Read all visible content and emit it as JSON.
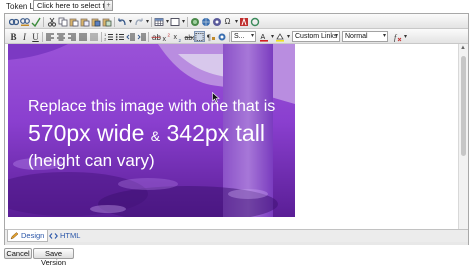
{
  "token_list": {
    "label": "Token List:",
    "select_value": "Click here to select tokens",
    "button_label": "+"
  },
  "toolbar2": {
    "style_dropdown": "S...",
    "links_dropdown": "Custom Links",
    "format_dropdown": "Normal"
  },
  "placeholder_image": {
    "line1": "Replace this image with one that is",
    "line2_a": "570px wide",
    "line2_amp": "&",
    "line2_b": "342px tall",
    "line3": "(height can vary)"
  },
  "mode_tabs": {
    "design": "Design",
    "html": "HTML"
  },
  "buttons": {
    "cancel": "Cancel",
    "save_version": "Save Version"
  },
  "colors": {
    "image_purple": "#8b3fd0",
    "link_blue": "#2b56a8"
  }
}
